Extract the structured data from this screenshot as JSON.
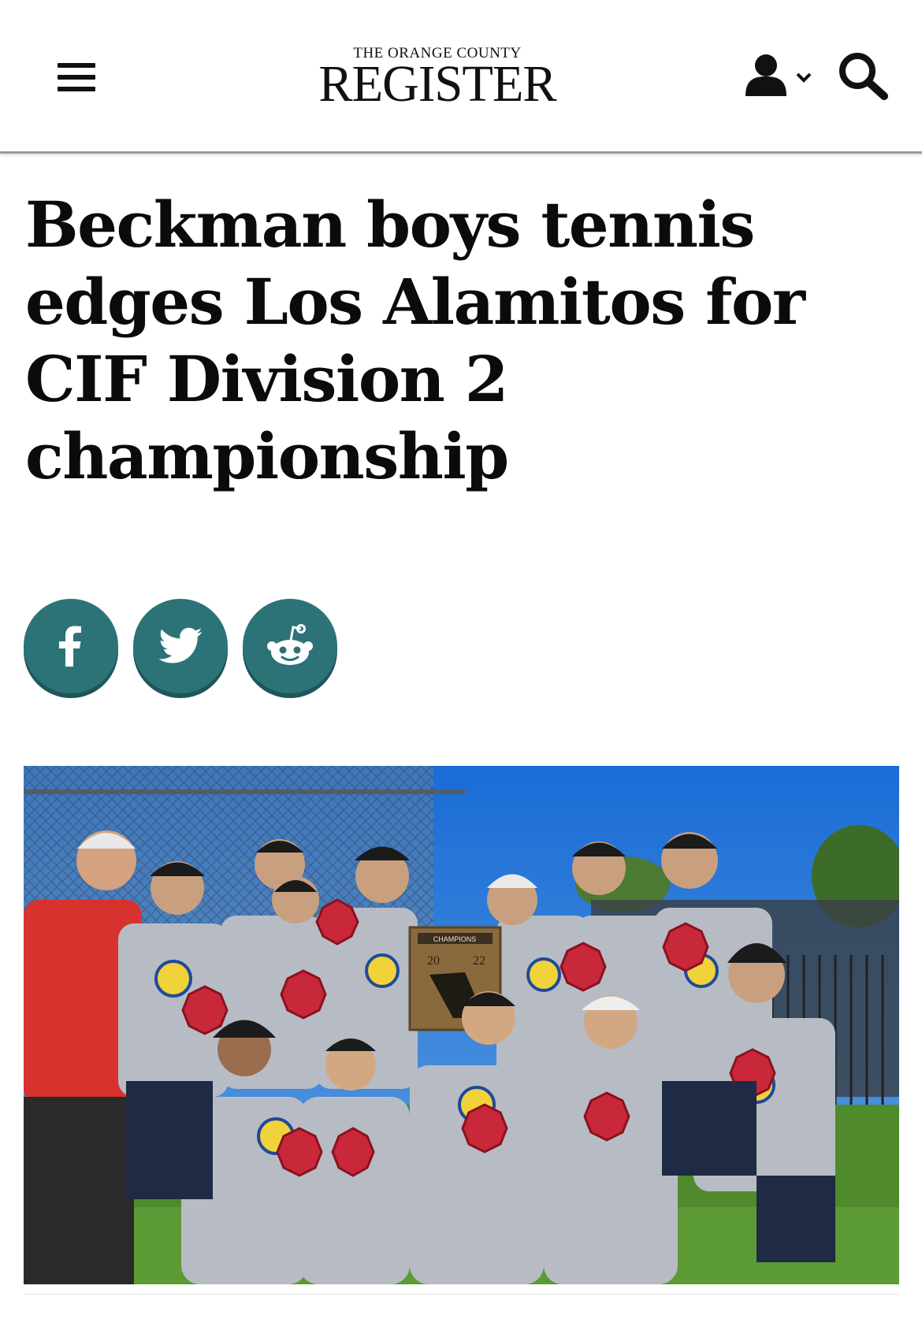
{
  "header": {
    "menu_icon": "hamburger-menu-icon",
    "logo": {
      "small": "THE ORANGE COUNTY",
      "main": "REGISTER"
    },
    "account_icon": "user-icon",
    "search_icon": "search-icon"
  },
  "article": {
    "headline": "Beckman boys tennis edges Los Alamitos for CIF Division 2 championship"
  },
  "share": [
    {
      "name": "facebook",
      "icon": "facebook-icon"
    },
    {
      "name": "twitter",
      "icon": "twitter-icon"
    },
    {
      "name": "reddit",
      "icon": "reddit-icon"
    }
  ],
  "photo": {
    "plaque_top": "CHAMPIONS",
    "plaque_year_left": "20",
    "plaque_year_right": "22"
  },
  "colors": {
    "share_button": "#2c7378",
    "shirt_red": "#d8322f",
    "sky": "#1d6fd1",
    "grass": "#4f8a2c"
  }
}
